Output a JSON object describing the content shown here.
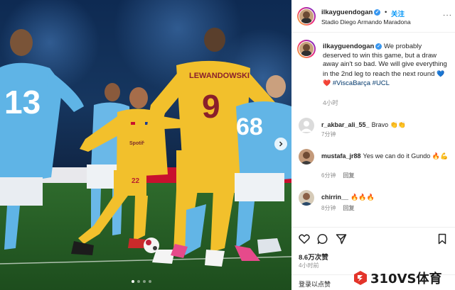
{
  "photo": {
    "players": [
      {
        "name_on_shirt": "",
        "number": "13"
      },
      {
        "name_on_shirt": "LEWANDOWSKI",
        "number": "9"
      },
      {
        "name_on_shirt": "",
        "number": "68"
      },
      {
        "name_on_shirt": "",
        "number": "22"
      }
    ],
    "sponsor": "Spotify",
    "carousel_dots": 4,
    "active_dot": 0
  },
  "header": {
    "username": "ilkayguendogan",
    "verified_mark": "✓",
    "separator": "•",
    "follow_label": "关注",
    "location": "Stadio Diego Armando Maradona",
    "more_label": "···"
  },
  "caption": {
    "username": "ilkayguendogan",
    "verified_mark": "✓",
    "text_before_hearts": "We probably deserved to win this game, but a draw away ain't so bad. We will give everything in the 2nd leg to reach the next round",
    "hearts": [
      "💙",
      "❤️"
    ],
    "hashtags": "#ViscaBarça #UCL",
    "time": "4小时"
  },
  "comments": [
    {
      "username": "r_akbar_ali_55_",
      "text": "Bravo 👏👏",
      "time": "7分钟",
      "reply": "回复",
      "avatar": "default-avatar"
    },
    {
      "username": "mustafa_jr88",
      "text": "Yes we can do it Gundo 🔥💪",
      "time": "6分钟",
      "reply": "回复",
      "avatar": "photo-avatar"
    },
    {
      "username": "chirrin__",
      "text": "🔥🔥🔥",
      "time": "8分钟",
      "reply": "回复",
      "avatar": "photo-avatar"
    }
  ],
  "actions": {
    "icons": [
      "heart-icon",
      "comment-icon",
      "share-icon",
      "bookmark-icon"
    ]
  },
  "likes": "8.6万次赞",
  "post_time": "4小时前",
  "login_prompt": "登录以点赞",
  "watermark": {
    "text": "310VS体育",
    "color": "#e3342a"
  }
}
